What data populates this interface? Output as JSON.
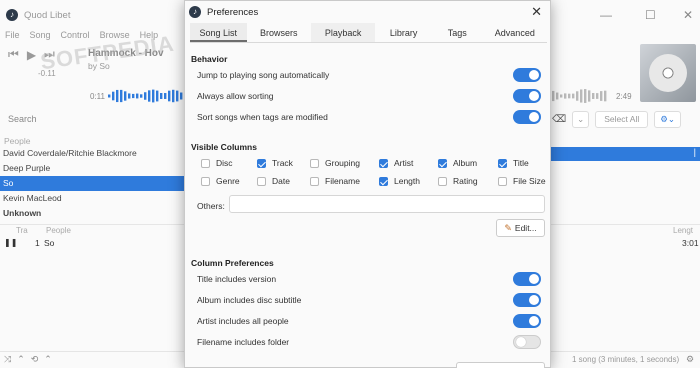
{
  "main": {
    "title": "Quod Libet",
    "menu": [
      "File",
      "Song",
      "Control",
      "Browse",
      "Help"
    ],
    "song_title": "Hammock - Hov",
    "song_by": "by So",
    "volume": "-0.11",
    "time_elapsed": "0:11",
    "time_remaining": "2:49",
    "search_label": "Search",
    "select_all": "Select All",
    "people_header": "People",
    "people": [
      "David Coverdale/Ritchie Blackmore",
      "Deep Purple",
      "So",
      "Kevin MacLeod",
      "Unknown"
    ],
    "people_selected_index": 2,
    "tracks_header": {
      "col1": "Tra",
      "col2": "People",
      "col3": "Lengt"
    },
    "track": {
      "num": "1",
      "name": "So",
      "length": "3:01"
    },
    "status": "1 song (3 minutes, 1 seconds)",
    "watermark": "SOFTPEDIA"
  },
  "dialog": {
    "title": "Preferences",
    "tabs": [
      "Song List",
      "Browsers",
      "Playback",
      "Library",
      "Tags",
      "Advanced"
    ],
    "active_tab": "Song List",
    "behavior": {
      "header": "Behavior",
      "items": [
        {
          "label": "Jump to playing song automatically",
          "on": true
        },
        {
          "label": "Always allow sorting",
          "on": true
        },
        {
          "label": "Sort songs when tags are modified",
          "on": true
        }
      ]
    },
    "visible_columns": {
      "header": "Visible Columns",
      "items": [
        {
          "label": "Disc",
          "checked": false
        },
        {
          "label": "Track",
          "checked": true
        },
        {
          "label": "Grouping",
          "checked": false
        },
        {
          "label": "Artist",
          "checked": true
        },
        {
          "label": "Album",
          "checked": true
        },
        {
          "label": "Title",
          "checked": true
        },
        {
          "label": "Genre",
          "checked": false
        },
        {
          "label": "Date",
          "checked": false
        },
        {
          "label": "Filename",
          "checked": false
        },
        {
          "label": "Length",
          "checked": true
        },
        {
          "label": "Rating",
          "checked": false
        },
        {
          "label": "File Size",
          "checked": false
        }
      ],
      "others_label": "Others:",
      "others_value": "",
      "edit_label": "Edit..."
    },
    "column_prefs": {
      "header": "Column Preferences",
      "items": [
        {
          "label": "Title includes version",
          "on": true
        },
        {
          "label": "Album includes disc subtitle",
          "on": true
        },
        {
          "label": "Artist includes all people",
          "on": true
        },
        {
          "label": "Filename includes folder",
          "on": false
        }
      ]
    }
  },
  "colors": {
    "accent": "#2f7bdc"
  }
}
